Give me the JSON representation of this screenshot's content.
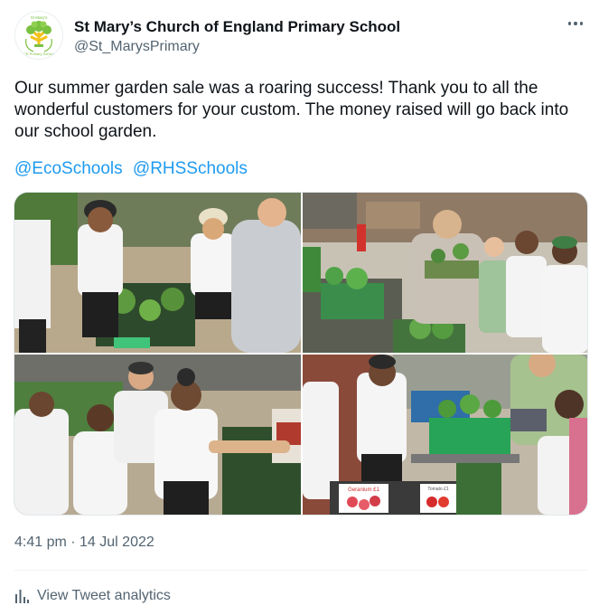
{
  "account": {
    "name": "St Mary’s Church of England Primary School",
    "handle": "@St_MarysPrimary",
    "logo_top_text": "St Mary's",
    "logo_bottom_text": "CE Primary School"
  },
  "tweet": {
    "text": "Our summer garden sale was a roaring success! Thank you to all the wonderful customers for your custom. The money raised will go back into our school garden.",
    "hashtags": [
      "@EcoSchools",
      "@RHSSchools"
    ],
    "timestamp": "4:41 pm · 14 Jul 2022"
  },
  "photo_sign": {
    "title": "Geranium £1",
    "subtitle": "Tomato £1"
  },
  "footer": {
    "analytics_label": "View Tweet analytics"
  },
  "colors": {
    "link": "#1d9bf0",
    "text": "#0f1419",
    "muted": "#536471",
    "logo_green": "#7ac142",
    "logo_yellow": "#f2c21b"
  },
  "icons": [
    "more-icon",
    "analytics-icon",
    "school-logo-icon"
  ]
}
